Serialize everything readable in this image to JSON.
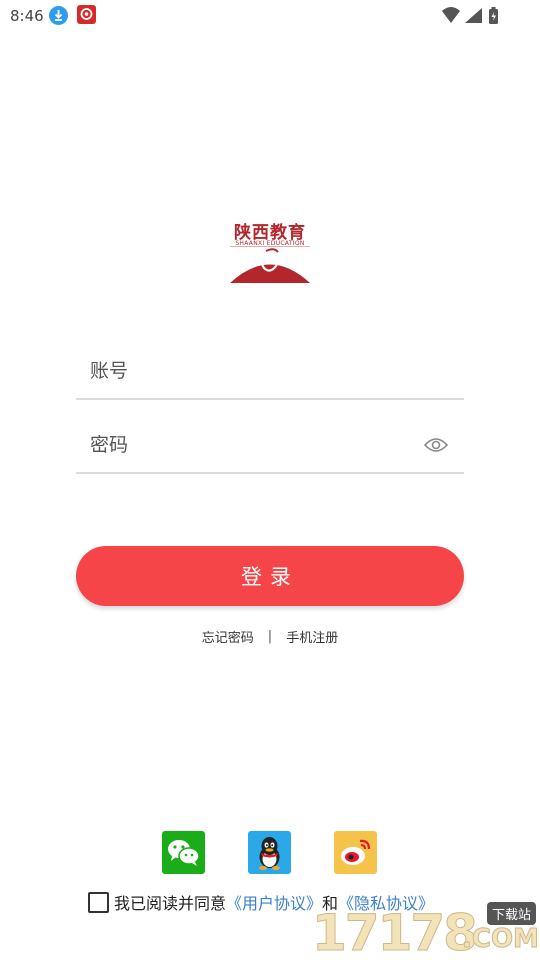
{
  "status_bar": {
    "time": "8:46"
  },
  "logo": {
    "title": "陕西教育",
    "subtitle": "SHAANXI EDUCATION"
  },
  "form": {
    "account_placeholder": "账号",
    "password_placeholder": "密码"
  },
  "login_label": "登录",
  "links": {
    "forgot": "忘记密码",
    "separator": "|",
    "register": "手机注册"
  },
  "social": [
    "wechat-icon",
    "qq-icon",
    "weibo-icon"
  ],
  "agreement": {
    "prefix": "我已阅读并同意",
    "user_agreement": "《用户协议》",
    "and": "和",
    "privacy_agreement": "《隐私协议》"
  },
  "watermark": {
    "digits": "17178",
    "suffix": ".COM",
    "tag": "下载站"
  },
  "colors": {
    "primary": "#f64548",
    "link": "#3a7fd0",
    "brand": "#b3262b"
  }
}
